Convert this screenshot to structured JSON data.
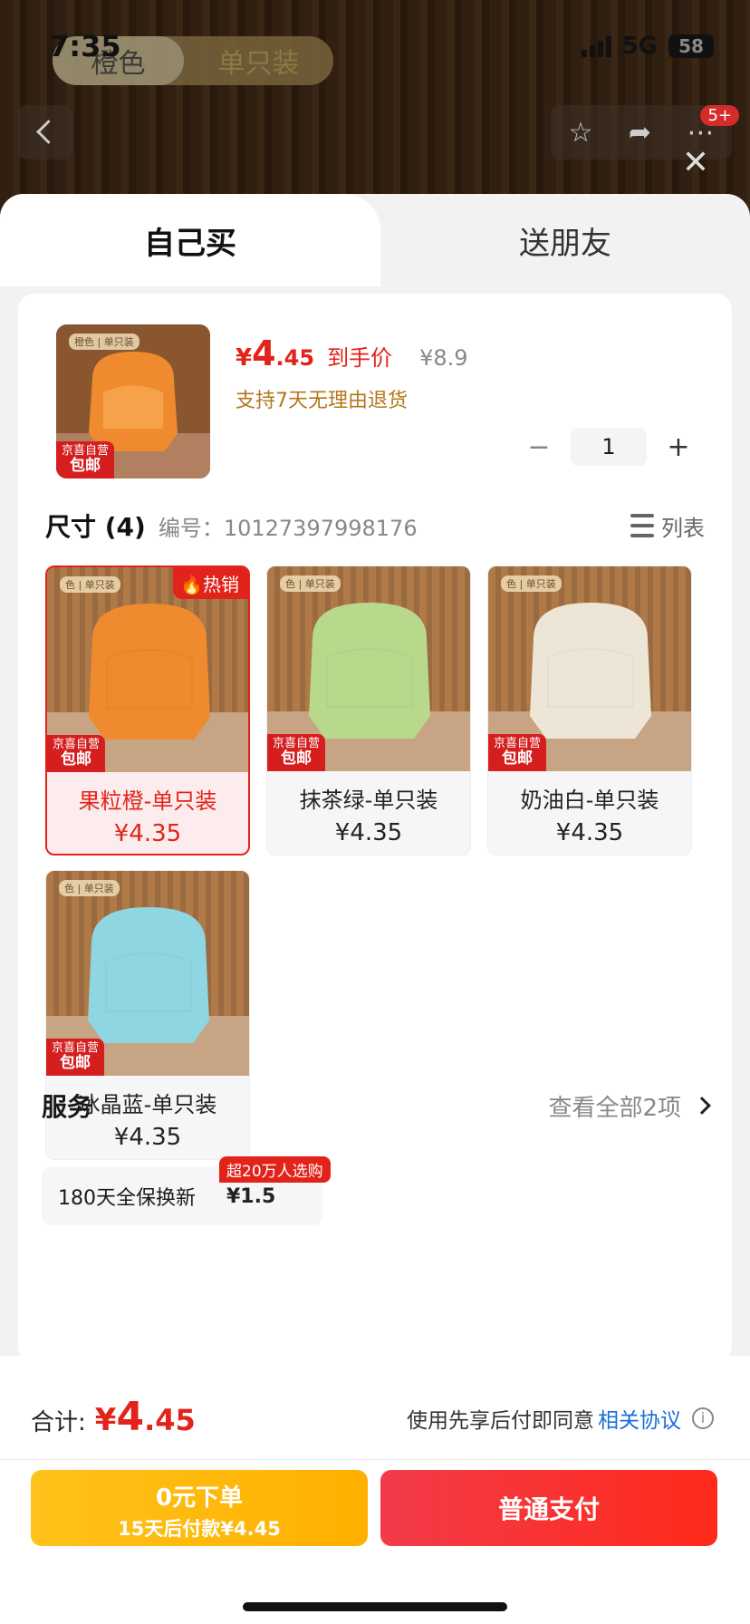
{
  "statusbar": {
    "time": "7:35",
    "network": "5G",
    "battery": "58"
  },
  "background": {
    "variant_pill_1": "橙色",
    "variant_pill_2": "单只装",
    "notification_badge": "5+"
  },
  "tabs": {
    "self": "自己买",
    "friend": "送朋友"
  },
  "product": {
    "price_yen": "¥",
    "price_int": "4",
    "price_dec": ".45",
    "price_tag": "到手价",
    "orig_price": "¥8.9",
    "return_policy": "支持7天无理由退货",
    "quantity": "1",
    "badge_line1": "京喜自营",
    "badge_line2": "包邮"
  },
  "size": {
    "title": "尺寸 (4)",
    "code": "编号：10127397998176",
    "list_toggle": "列表"
  },
  "options": [
    {
      "name": "果粒橙-单只装",
      "price": "¥4.35",
      "hot": "🔥热销",
      "color": "#ef8a2e",
      "selected": true
    },
    {
      "name": "抹茶绿-单只装",
      "price": "¥4.35",
      "color": "#b8d98c",
      "selected": false
    },
    {
      "name": "奶油白-单只装",
      "price": "¥4.35",
      "color": "#ede6d6",
      "selected": false
    },
    {
      "name": "冰晶蓝-单只装",
      "price": "¥4.35",
      "color": "#8fd6e3",
      "selected": false
    }
  ],
  "service": {
    "title": "服务",
    "more": "查看全部2项",
    "item_name": "180天全保换新",
    "item_price": "¥1.5",
    "item_badge": "超20万人选购"
  },
  "footer": {
    "total_label": "合计:",
    "total_yen": "¥",
    "total_int": "4",
    "total_dec": ".45",
    "agree_text": "使用先享后付即同意",
    "agree_link": "相关协议",
    "btn_yellow_line1": "0元下单",
    "btn_yellow_line2": "15天后付款¥4.45",
    "btn_red": "普通支付"
  }
}
